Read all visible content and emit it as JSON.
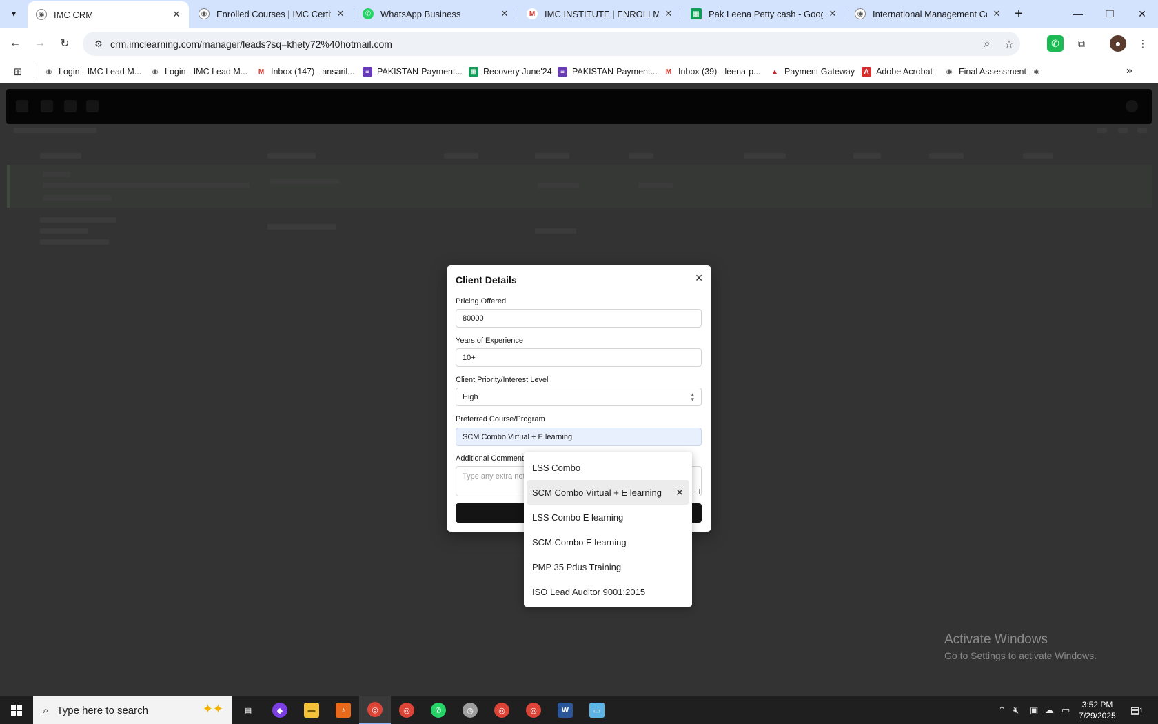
{
  "browser": {
    "tabs": [
      {
        "title": "IMC CRM",
        "active": true,
        "icon": "imc-icon"
      },
      {
        "title": "Enrolled Courses | IMC Certifica",
        "active": false,
        "icon": "imc-icon"
      },
      {
        "title": "WhatsApp Business",
        "active": false,
        "icon": "whatsapp-icon"
      },
      {
        "title": "IMC INSTITUTE | ENROLLMENT",
        "active": false,
        "icon": "gmail-icon"
      },
      {
        "title": "Pak Leena Petty cash - Google S",
        "active": false,
        "icon": "sheets-icon"
      },
      {
        "title": "International Management Con",
        "active": false,
        "icon": "imc-icon"
      }
    ],
    "url": "crm.imclearning.com/manager/leads?sq=khety72%40hotmail.com",
    "bookmarks": [
      {
        "label": "Login - IMC Lead M...",
        "icon": "imc-icon"
      },
      {
        "label": "Login - IMC Lead M...",
        "icon": "imc-icon"
      },
      {
        "label": "Inbox (147) - ansaril...",
        "icon": "gmail-icon"
      },
      {
        "label": "PAKISTAN-Payment...",
        "icon": "forms-icon"
      },
      {
        "label": "Recovery June'24",
        "icon": "sheets-icon"
      },
      {
        "label": "PAKISTAN-Payment...",
        "icon": "forms-icon"
      },
      {
        "label": "Inbox (39) - leena-p...",
        "icon": "gmail-icon"
      },
      {
        "label": "Payment Gateway",
        "icon": "gateway-icon"
      },
      {
        "label": "Adobe Acrobat",
        "icon": "acrobat-icon"
      },
      {
        "label": "Final Assessment",
        "icon": "imc-icon"
      }
    ]
  },
  "modal": {
    "title": "Client Details",
    "fields": {
      "pricing": {
        "label": "Pricing Offered",
        "value": "80000"
      },
      "experience": {
        "label": "Years of Experience",
        "value": "10+"
      },
      "priority": {
        "label": "Client Priority/Interest Level",
        "value": "High"
      },
      "course": {
        "label": "Preferred Course/Program",
        "value": "SCM Combo Virtual + E learning"
      },
      "comments": {
        "label": "Additional Comment",
        "placeholder": "Type any extra note"
      }
    }
  },
  "dropdown": {
    "options": [
      {
        "label": "LSS Combo",
        "selected": false
      },
      {
        "label": "SCM Combo Virtual + E learning",
        "selected": true
      },
      {
        "label": "LSS Combo E learning",
        "selected": false
      },
      {
        "label": "SCM Combo E learning",
        "selected": false
      },
      {
        "label": "PMP 35 Pdus Training",
        "selected": false
      },
      {
        "label": "ISO Lead Auditor 9001:2015",
        "selected": false
      }
    ]
  },
  "watermark": {
    "line1": "Activate Windows",
    "line2": "Go to Settings to activate Windows."
  },
  "taskbar": {
    "search_placeholder": "Type here to search",
    "time": "3:52 PM",
    "date": "7/29/2025",
    "notification_count": "1"
  },
  "colors": {
    "tabstrip": "#d3e3fd",
    "overlay": "#333333",
    "modal_button": "#141414",
    "selected_option": "#ececec"
  }
}
